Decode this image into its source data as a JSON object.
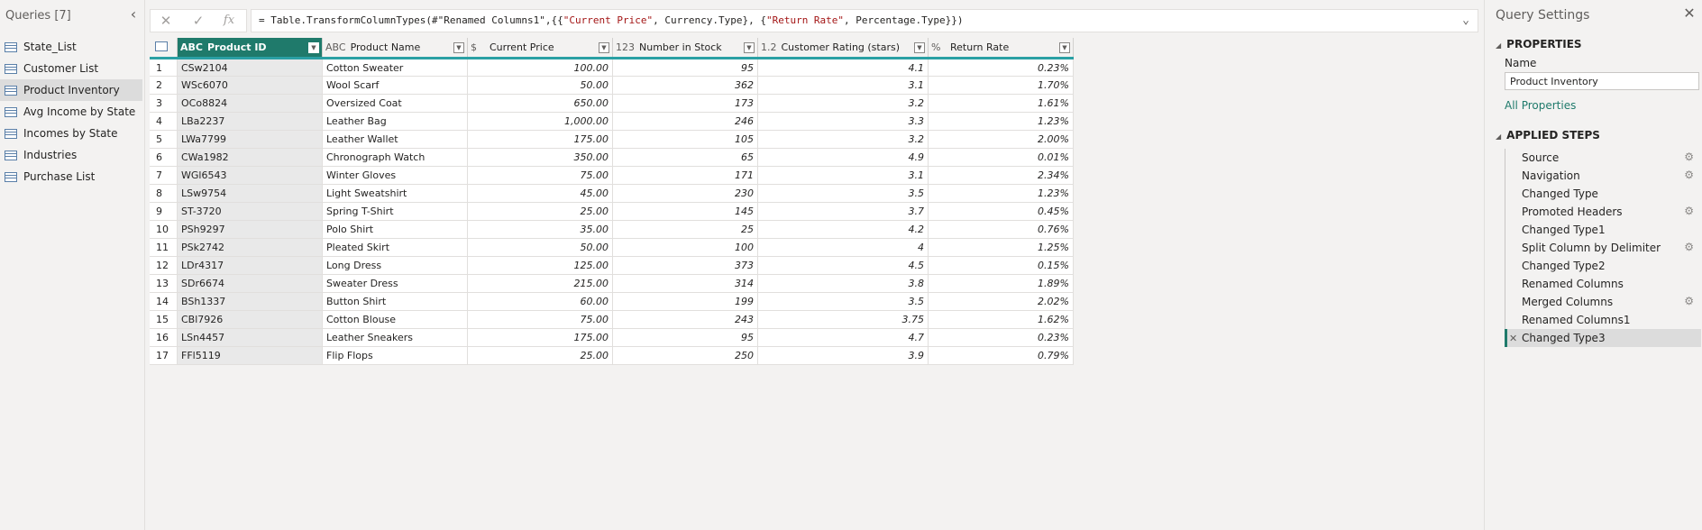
{
  "queries_pane": {
    "header": "Queries [7]",
    "items": [
      {
        "label": "State_List"
      },
      {
        "label": "Customer List"
      },
      {
        "label": "Product Inventory",
        "selected": true
      },
      {
        "label": "Avg Income by State"
      },
      {
        "label": "Incomes by State"
      },
      {
        "label": "Industries"
      },
      {
        "label": "Purchase List"
      }
    ]
  },
  "formula_bar": {
    "cancel_icon": "✕",
    "commit_icon": "✓",
    "fx_label": "fx",
    "formula_prefix": "= Table.TransformColumnTypes(#\"Renamed Columns1\",{{",
    "str1": "\"Current Price\"",
    "mid1": ", Currency.Type}, {",
    "str2": "\"Return Rate\"",
    "mid2": ", Percentage.Type}})"
  },
  "table": {
    "columns": [
      {
        "name": "Product ID",
        "type_icon": "ABC",
        "active": true
      },
      {
        "name": "Product Name",
        "type_icon": "ABC"
      },
      {
        "name": "Current Price",
        "type_icon": "$"
      },
      {
        "name": "Number in Stock",
        "type_icon": "123"
      },
      {
        "name": "Customer Rating (stars)",
        "type_icon": "1.2"
      },
      {
        "name": "Return Rate",
        "type_icon": "%"
      }
    ],
    "rows": [
      [
        "1",
        "CSw2104",
        "Cotton Sweater",
        "100.00",
        "95",
        "4.1",
        "0.23%"
      ],
      [
        "2",
        "WSc6070",
        "Wool Scarf",
        "50.00",
        "362",
        "3.1",
        "1.70%"
      ],
      [
        "3",
        "OCo8824",
        "Oversized Coat",
        "650.00",
        "173",
        "3.2",
        "1.61%"
      ],
      [
        "4",
        "LBa2237",
        "Leather Bag",
        "1,000.00",
        "246",
        "3.3",
        "1.23%"
      ],
      [
        "5",
        "LWa7799",
        "Leather Wallet",
        "175.00",
        "105",
        "3.2",
        "2.00%"
      ],
      [
        "6",
        "CWa1982",
        "Chronograph Watch",
        "350.00",
        "65",
        "4.9",
        "0.01%"
      ],
      [
        "7",
        "WGl6543",
        "Winter Gloves",
        "75.00",
        "171",
        "3.1",
        "2.34%"
      ],
      [
        "8",
        "LSw9754",
        "Light Sweatshirt",
        "45.00",
        "230",
        "3.5",
        "1.23%"
      ],
      [
        "9",
        "ST-3720",
        "Spring T-Shirt",
        "25.00",
        "145",
        "3.7",
        "0.45%"
      ],
      [
        "10",
        "PSh9297",
        "Polo Shirt",
        "35.00",
        "25",
        "4.2",
        "0.76%"
      ],
      [
        "11",
        "PSk2742",
        "Pleated Skirt",
        "50.00",
        "100",
        "4",
        "1.25%"
      ],
      [
        "12",
        "LDr4317",
        "Long Dress",
        "125.00",
        "373",
        "4.5",
        "0.15%"
      ],
      [
        "13",
        "SDr6674",
        "Sweater Dress",
        "215.00",
        "314",
        "3.8",
        "1.89%"
      ],
      [
        "14",
        "BSh1337",
        "Button Shirt",
        "60.00",
        "199",
        "3.5",
        "2.02%"
      ],
      [
        "15",
        "CBl7926",
        "Cotton Blouse",
        "75.00",
        "243",
        "3.75",
        "1.62%"
      ],
      [
        "16",
        "LSn4457",
        "Leather Sneakers",
        "175.00",
        "95",
        "4.7",
        "0.23%"
      ],
      [
        "17",
        "FFl5119",
        "Flip Flops",
        "25.00",
        "250",
        "3.9",
        "0.79%"
      ]
    ]
  },
  "settings": {
    "title": "Query Settings",
    "close_icon": "✕",
    "properties_title": "PROPERTIES",
    "name_label": "Name",
    "name_value": "Product Inventory",
    "all_properties": "All Properties",
    "steps_title": "APPLIED STEPS",
    "steps": [
      {
        "label": "Source",
        "gear": true
      },
      {
        "label": "Navigation",
        "gear": true
      },
      {
        "label": "Changed Type",
        "gear": false
      },
      {
        "label": "Promoted Headers",
        "gear": true
      },
      {
        "label": "Changed Type1",
        "gear": false
      },
      {
        "label": "Split Column by Delimiter",
        "gear": true
      },
      {
        "label": "Changed Type2",
        "gear": false
      },
      {
        "label": "Renamed Columns",
        "gear": false
      },
      {
        "label": "Merged Columns",
        "gear": true
      },
      {
        "label": "Renamed Columns1",
        "gear": false
      },
      {
        "label": "Changed Type3",
        "gear": false,
        "selected": true
      }
    ]
  },
  "colors": {
    "accent": "#1f7a6b",
    "header_underline": "#2aa0a4"
  }
}
